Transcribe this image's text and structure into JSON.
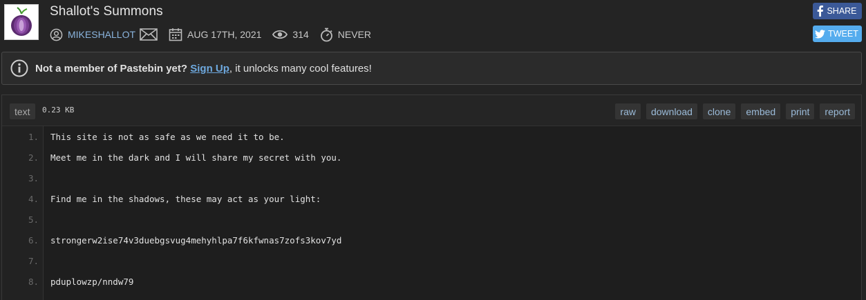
{
  "paste": {
    "title": "Shallot's Summons",
    "author": "MIKESHALLOT",
    "date": "AUG 17TH, 2021",
    "views": "314",
    "expiry": "NEVER"
  },
  "social": {
    "share_label": "SHARE",
    "tweet_label": "TWEET",
    "colors": {
      "facebook": "#3b5998",
      "twitter": "#55acee"
    }
  },
  "notice": {
    "lead": "Not a member of Pastebin yet?",
    "link": "Sign Up",
    "rest": ", it unlocks many cool features!"
  },
  "toolbar": {
    "syntax": "text",
    "size": "0.23 KB",
    "actions": [
      "raw",
      "download",
      "clone",
      "embed",
      "print",
      "report"
    ]
  },
  "lines": [
    {
      "num": "1.",
      "text": "This site is not as safe as we need it to be."
    },
    {
      "num": "2.",
      "text": "Meet me in the dark and I will share my secret with you."
    },
    {
      "num": "3.",
      "text": ""
    },
    {
      "num": "4.",
      "text": "Find me in the shadows, these may act as your light:"
    },
    {
      "num": "5.",
      "text": ""
    },
    {
      "num": "6.",
      "text": "strongerw2ise74v3duebgsvug4mehyhlpa7f6kfwnas7zofs3kov7yd"
    },
    {
      "num": "7.",
      "text": ""
    },
    {
      "num": "8.",
      "text": "pduplowzp/nndw79"
    }
  ],
  "icons": {
    "avatar": "onion-logo",
    "author": "user-icon",
    "message": "envelope-icon",
    "date": "calendar-icon",
    "views": "eye-icon",
    "expiry": "stopwatch-icon",
    "notice": "info-icon"
  }
}
